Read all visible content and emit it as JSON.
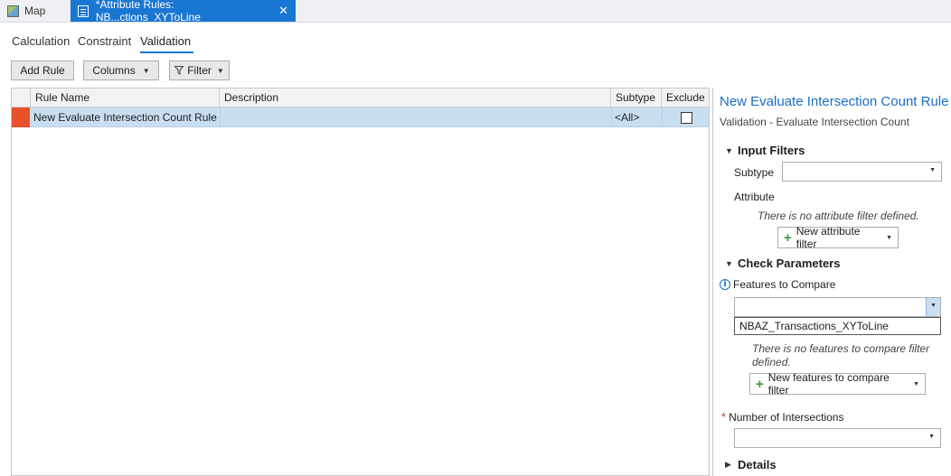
{
  "tabs": {
    "map": "Map",
    "attribute_rules": "*Attribute Rules: NB...ctions_XYToLine",
    "close_glyph": "✕"
  },
  "subtabs": [
    "Calculation",
    "Constraint",
    "Validation"
  ],
  "toolbar": {
    "add_rule": "Add Rule",
    "columns": "Columns",
    "filter": "Filter"
  },
  "table": {
    "columns": [
      "Rule Name",
      "Description",
      "Subtype",
      "Exclude"
    ],
    "rows": [
      {
        "rule_name": "New Evaluate Intersection Count Rule",
        "description": "",
        "subtype": "<All>",
        "exclude": false
      }
    ]
  },
  "panel": {
    "title": "New Evaluate Intersection Count Rule",
    "subtitle": "Validation - Evaluate Intersection Count",
    "input_filters": {
      "header": "Input Filters",
      "subtype_label": "Subtype",
      "subtype_value": "",
      "attribute_label": "Attribute",
      "no_attribute_filter": "There is no attribute filter defined.",
      "new_attribute_filter": "New attribute filter"
    },
    "check_parameters": {
      "header": "Check Parameters",
      "features_to_compare_label": "Features to Compare",
      "features_to_compare_value": "",
      "dropdown_option": "NBAZ_Transactions_XYToLine",
      "no_features_filter_line1": "There is no features to compare filter",
      "no_features_filter_line2": "defined.",
      "new_features_filter": "New features to compare filter",
      "number_of_intersections_label": "Number of Intersections",
      "number_of_intersections_value": "",
      "required_marker": "*"
    },
    "details_header": "Details"
  },
  "colors": {
    "accent": "#1976d2",
    "title_blue": "#1b6ec2",
    "selected_row": "#c9def1",
    "row_indicator": "#e8512c"
  }
}
